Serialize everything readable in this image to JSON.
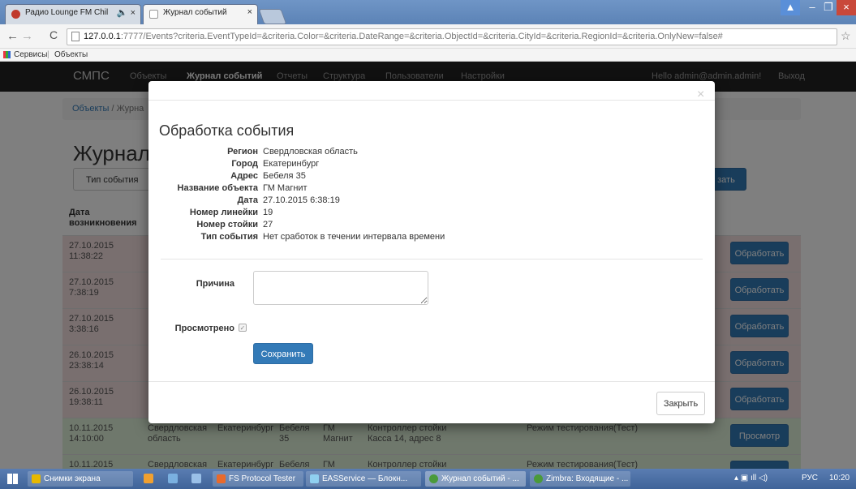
{
  "browser": {
    "tabs": [
      {
        "label": "Радио Lounge FM Chil"
      },
      {
        "label": "Журнал событий"
      }
    ],
    "url_host": "127.0.0.1",
    "url_rest": ":7777/Events?criteria.EventTypeId=&criteria.Color=&criteria.DateRange=&criteria.ObjectId=&criteria.CityId=&criteria.RegionId=&criteria.OnlyNew=false#",
    "bookmarks": [
      {
        "label": "Сервисы"
      },
      {
        "label": "Объекты"
      }
    ]
  },
  "app": {
    "brand": "СМПС",
    "nav": [
      "Объекты",
      "Журнал событий",
      "Отчеты",
      "Структура",
      "Пользователи",
      "Настройки"
    ],
    "user": "Hello admin@admin.admin!",
    "logout": "Выход",
    "breadcrumb": [
      "Объекты",
      "Журна"
    ],
    "title": "Журнал",
    "filter_event_type": "Тип события",
    "filter_button": "зать",
    "table_header_date": "Дата возникновения"
  },
  "rows": [
    {
      "date": "27.10.2015",
      "time": "11:38:22",
      "action": "Обработать",
      "color": "#f2dede"
    },
    {
      "date": "27.10.2015",
      "time": "7:38:19",
      "action": "Обработать",
      "color": "#f2dede"
    },
    {
      "date": "27.10.2015",
      "time": "3:38:16",
      "action": "Обработать",
      "color": "#f2dede"
    },
    {
      "date": "26.10.2015",
      "time": "23:38:14",
      "action": "Обработать",
      "color": "#f2dede"
    },
    {
      "date": "26.10.2015",
      "time": "19:38:11",
      "action": "Обработать",
      "color": "#f2dede"
    },
    {
      "date": "10.11.2015",
      "time": "14:10:00",
      "region": "Свердловская область",
      "city": "Екатеринбург",
      "address": "Бебеля 35",
      "object": "ГМ Магнит",
      "device": "Контроллер стойки Касса 14, адрес 8",
      "type": "Режим тестирования(Тест)",
      "action": "Просмотр",
      "color": "#dff0d8"
    },
    {
      "date": "10.11.2015",
      "time": "",
      "region": "Свердловская",
      "city": "Екатеринбург",
      "address": "Бебеля",
      "object": "ГМ",
      "device": "Контроллер стойки",
      "type": "Режим тестирования(Тест)",
      "action": "Просмотр",
      "color": "#dff0d8"
    }
  ],
  "modal": {
    "close_x": "×",
    "title": "Обработка события",
    "fields": [
      {
        "label": "Регион",
        "value": "Свердловская область"
      },
      {
        "label": "Город",
        "value": "Екатеринбург"
      },
      {
        "label": "Адрес",
        "value": "Бебеля 35"
      },
      {
        "label": "Название объекта",
        "value": "ГМ Магнит"
      },
      {
        "label": "Дата",
        "value": "27.10.2015 6:38:19"
      },
      {
        "label": "Номер линейки",
        "value": "19"
      },
      {
        "label": "Номер стойки",
        "value": "27"
      },
      {
        "label": "Тип события",
        "value": "Нет сработок в течении интервала времени"
      }
    ],
    "reason_label": "Причина",
    "reason_value": "",
    "viewed_label": "Просмотрено",
    "viewed_checked": true,
    "save": "Сохранить",
    "close": "Закрыть"
  },
  "taskbar": {
    "items": [
      {
        "label": "Снимки экрана"
      },
      {
        "label": "FS Protocol Tester"
      },
      {
        "label": "EASService — Блокн..."
      },
      {
        "label": "Журнал событий - ..."
      },
      {
        "label": "Zimbra: Входящие - ..."
      }
    ],
    "lang": "РУС",
    "clock": "10:20"
  }
}
